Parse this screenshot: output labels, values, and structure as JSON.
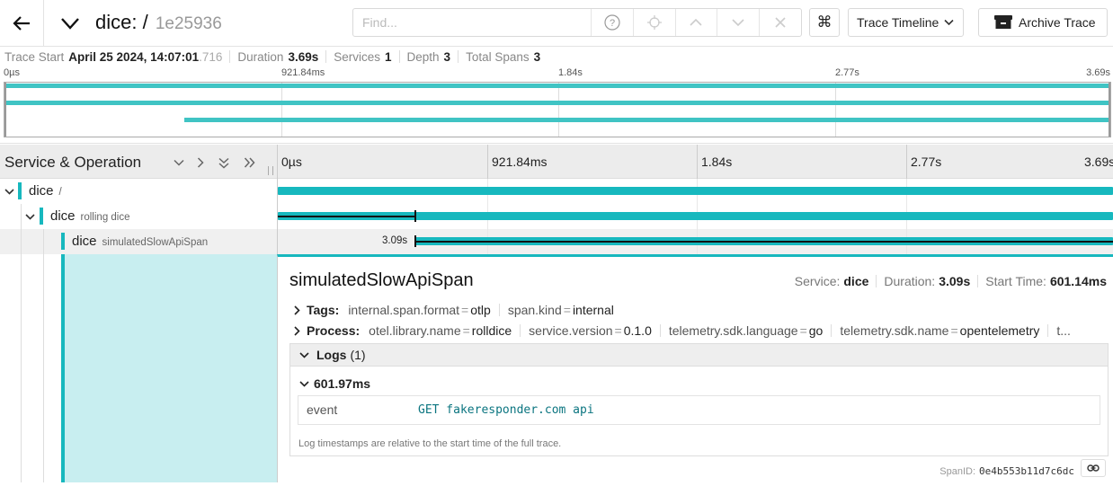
{
  "header": {
    "trace_name": "dice: /",
    "trace_id": "1e25936",
    "find_placeholder": "Find...",
    "view_select": "Trace Timeline",
    "archive_label": "Archive Trace",
    "kbd_glyph": "⌘"
  },
  "summary": {
    "start_label": "Trace Start",
    "start_value": "April 25 2024, 14:07:01",
    "start_ms": ".716",
    "duration_label": "Duration",
    "duration_value": "3.69s",
    "services_label": "Services",
    "services_value": "1",
    "depth_label": "Depth",
    "depth_value": "3",
    "spans_label": "Total Spans",
    "spans_value": "3"
  },
  "ticks": [
    "0µs",
    "921.84ms",
    "1.84s",
    "2.77s",
    "3.69s"
  ],
  "timeline_header": {
    "title": "Service & Operation"
  },
  "spans": [
    {
      "service": "dice",
      "operation": "/",
      "start_frac": 0.0,
      "end_frac": 1.0
    },
    {
      "service": "dice",
      "operation": "rolling dice",
      "start_frac": 0.0,
      "end_frac": 1.0
    },
    {
      "service": "dice",
      "operation": "simulatedSlowApiSpan",
      "start_frac": 0.163,
      "end_frac": 1.0,
      "label": "3.09s"
    }
  ],
  "detail": {
    "title": "simulatedSlowApiSpan",
    "service_label": "Service:",
    "service_value": "dice",
    "duration_label": "Duration:",
    "duration_value": "3.09s",
    "start_label": "Start Time:",
    "start_value": "601.14ms",
    "tags_label": "Tags:",
    "tags": [
      {
        "key": "internal.span.format",
        "value": "otlp"
      },
      {
        "key": "span.kind",
        "value": "internal"
      }
    ],
    "process_label": "Process:",
    "process": [
      {
        "key": "otel.library.name",
        "value": "rolldice"
      },
      {
        "key": "service.version",
        "value": "0.1.0"
      },
      {
        "key": "telemetry.sdk.language",
        "value": "go"
      },
      {
        "key": "telemetry.sdk.name",
        "value": "opentelemetry"
      }
    ],
    "process_more": "t...",
    "logs_label": "Logs",
    "logs_count": "(1)",
    "log_ts": "601.97ms",
    "log_key": "event",
    "log_value": "GET fakeresponder.com api",
    "log_note": "Log timestamps are relative to the start time of the full trace.",
    "span_id_label": "SpanID:",
    "span_id_value": "0e4b553b11d7c6dc"
  },
  "colors": {
    "accent": "#17b8be",
    "minimap_bar": "#40c4c4",
    "selected_bg": "#c8eef0"
  }
}
